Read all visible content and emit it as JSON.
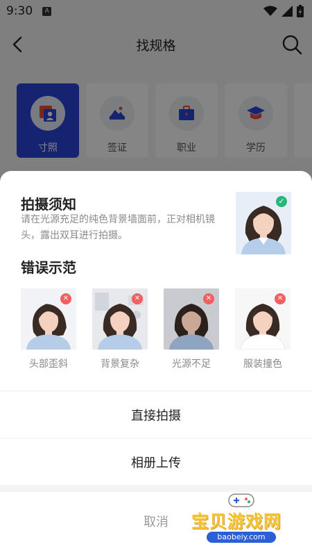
{
  "status_bar": {
    "time": "9:30",
    "notification_letter": "A"
  },
  "navbar": {
    "title": "找规格"
  },
  "categories": [
    {
      "label": "寸照",
      "icon": "portrait-photo-icon",
      "active": true
    },
    {
      "label": "签证",
      "icon": "mountain-photo-icon",
      "active": false
    },
    {
      "label": "职业",
      "icon": "briefcase-icon",
      "active": false
    },
    {
      "label": "学历",
      "icon": "graduation-cap-icon",
      "active": false
    }
  ],
  "sheet": {
    "guide_title": "拍摄须知",
    "guide_text": "请在光源充足的纯色背景墙面前，正对相机镜头，露出双耳进行拍摄。",
    "wrong_title": "错误示范",
    "wrong_examples": [
      {
        "label": "头部歪斜"
      },
      {
        "label": "背景复杂"
      },
      {
        "label": "光源不足"
      },
      {
        "label": "服装撞色"
      }
    ],
    "shoot_label": "直接拍摄",
    "album_label": "相册上传",
    "cancel_label": "取消"
  },
  "watermark": {
    "text": "宝贝游戏网",
    "url": "baobeiy.com"
  },
  "colors": {
    "accent": "#2b44d8",
    "check": "#27b67a",
    "error": "#f06060"
  }
}
